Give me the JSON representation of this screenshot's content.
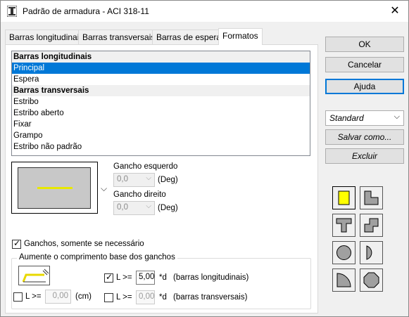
{
  "window": {
    "title": "Padrão de armadura - ACI 318-11",
    "close_glyph": "✕"
  },
  "tabs": [
    {
      "label": "Barras longitudinais"
    },
    {
      "label": "Barras transversais"
    },
    {
      "label": "Barras de espera"
    },
    {
      "label": "Formatos"
    }
  ],
  "active_tab": "Formatos",
  "shape_list": [
    {
      "label": "Barras longitudinais",
      "kind": "group"
    },
    {
      "label": "Principal",
      "kind": "item",
      "selected": true
    },
    {
      "label": "Espera",
      "kind": "item"
    },
    {
      "label": "Barras transversais",
      "kind": "group"
    },
    {
      "label": "Estribo",
      "kind": "item"
    },
    {
      "label": "Estribo aberto",
      "kind": "item"
    },
    {
      "label": "Fixar",
      "kind": "item"
    },
    {
      "label": "Grampo",
      "kind": "item"
    },
    {
      "label": "Estribo não padrão",
      "kind": "item"
    }
  ],
  "preview": {
    "bar_color": "#e8e800",
    "dropdown_glyph": "⌵"
  },
  "hooks": {
    "left_label": "Gancho esquerdo",
    "left_value": "0,0",
    "left_unit": "(Deg)",
    "right_label": "Gancho direito",
    "right_value": "0,0",
    "right_unit": "(Deg)"
  },
  "only_if_needed": {
    "label": "Ganchos, somente se necessário",
    "checked": true
  },
  "increase_group": {
    "title": "Aumente o comprimento base dos ganchos",
    "l_ge_label": "L >=",
    "row1_checked": true,
    "row1_value": "5,00",
    "row1_unit": "*d",
    "row1_desc": "(barras longitudinais)",
    "row2_checked": false,
    "row2_value": "0,00",
    "row2_unit": "*d",
    "row2_desc": "(barras transversais)",
    "cm_checked": false,
    "cm_value": "0,00",
    "cm_unit": "(cm)"
  },
  "buttons": {
    "ok": "OK",
    "cancel": "Cancelar",
    "help": "Ajuda",
    "preset": "Standard",
    "save_as": "Salvar como...",
    "delete": "Excluir"
  },
  "shape_buttons": [
    {
      "name": "square-shape-icon"
    },
    {
      "name": "l-shape-icon"
    },
    {
      "name": "t-shape-icon"
    },
    {
      "name": "z-shape-icon"
    },
    {
      "name": "circle-shape-icon"
    },
    {
      "name": "half-circle-shape-icon"
    },
    {
      "name": "quarter-circle-shape-icon"
    },
    {
      "name": "octagon-shape-icon"
    }
  ],
  "colors": {
    "selection": "#0078d7",
    "focus": "#0078d7",
    "highlight_shape": "#ffff00"
  }
}
